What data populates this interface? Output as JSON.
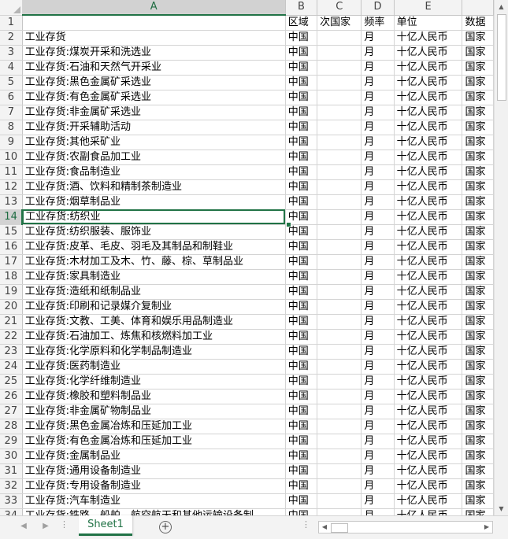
{
  "columns": [
    "A",
    "B",
    "C",
    "D",
    "E",
    ""
  ],
  "active_column": "A",
  "rows": [
    {
      "n": "1",
      "a": "",
      "b": "区域",
      "c": "次国家",
      "d": "频率",
      "e": "单位",
      "f": "数据"
    },
    {
      "n": "2",
      "a": "工业存货",
      "b": "中国",
      "c": "",
      "d": "月",
      "e": "十亿人民币",
      "f": "国家"
    },
    {
      "n": "3",
      "a": "工业存货:煤炭开采和洗选业",
      "b": "中国",
      "c": "",
      "d": "月",
      "e": "十亿人民币",
      "f": "国家"
    },
    {
      "n": "4",
      "a": "工业存货:石油和天然气开采业",
      "b": "中国",
      "c": "",
      "d": "月",
      "e": "十亿人民币",
      "f": "国家"
    },
    {
      "n": "5",
      "a": "工业存货:黑色金属矿采选业",
      "b": "中国",
      "c": "",
      "d": "月",
      "e": "十亿人民币",
      "f": "国家"
    },
    {
      "n": "6",
      "a": "工业存货:有色金属矿采选业",
      "b": "中国",
      "c": "",
      "d": "月",
      "e": "十亿人民币",
      "f": "国家"
    },
    {
      "n": "7",
      "a": "工业存货:非金属矿采选业",
      "b": "中国",
      "c": "",
      "d": "月",
      "e": "十亿人民币",
      "f": "国家"
    },
    {
      "n": "8",
      "a": "工业存货:开采辅助活动",
      "b": "中国",
      "c": "",
      "d": "月",
      "e": "十亿人民币",
      "f": "国家"
    },
    {
      "n": "9",
      "a": "工业存货:其他采矿业",
      "b": "中国",
      "c": "",
      "d": "月",
      "e": "十亿人民币",
      "f": "国家"
    },
    {
      "n": "10",
      "a": "工业存货:农副食品加工业",
      "b": "中国",
      "c": "",
      "d": "月",
      "e": "十亿人民币",
      "f": "国家"
    },
    {
      "n": "11",
      "a": "工业存货:食品制造业",
      "b": "中国",
      "c": "",
      "d": "月",
      "e": "十亿人民币",
      "f": "国家"
    },
    {
      "n": "12",
      "a": "工业存货:酒、饮料和精制茶制造业",
      "b": "中国",
      "c": "",
      "d": "月",
      "e": "十亿人民币",
      "f": "国家"
    },
    {
      "n": "13",
      "a": "工业存货:烟草制品业",
      "b": "中国",
      "c": "",
      "d": "月",
      "e": "十亿人民币",
      "f": "国家"
    },
    {
      "n": "14",
      "a": "工业存货:纺织业",
      "b": "中国",
      "c": "",
      "d": "月",
      "e": "十亿人民币",
      "f": "国家"
    },
    {
      "n": "15",
      "a": "工业存货:纺织服装、服饰业",
      "b": "中国",
      "c": "",
      "d": "月",
      "e": "十亿人民币",
      "f": "国家"
    },
    {
      "n": "16",
      "a": "工业存货:皮革、毛皮、羽毛及其制品和制鞋业",
      "b": "中国",
      "c": "",
      "d": "月",
      "e": "十亿人民币",
      "f": "国家"
    },
    {
      "n": "17",
      "a": "工业存货:木材加工及木、竹、藤、棕、草制品业",
      "b": "中国",
      "c": "",
      "d": "月",
      "e": "十亿人民币",
      "f": "国家"
    },
    {
      "n": "18",
      "a": "工业存货:家具制造业",
      "b": "中国",
      "c": "",
      "d": "月",
      "e": "十亿人民币",
      "f": "国家"
    },
    {
      "n": "19",
      "a": "工业存货:造纸和纸制品业",
      "b": "中国",
      "c": "",
      "d": "月",
      "e": "十亿人民币",
      "f": "国家"
    },
    {
      "n": "20",
      "a": "工业存货:印刷和记录媒介复制业",
      "b": "中国",
      "c": "",
      "d": "月",
      "e": "十亿人民币",
      "f": "国家"
    },
    {
      "n": "21",
      "a": "工业存货:文教、工美、体育和娱乐用品制造业",
      "b": "中国",
      "c": "",
      "d": "月",
      "e": "十亿人民币",
      "f": "国家"
    },
    {
      "n": "22",
      "a": "工业存货:石油加工、炼焦和核燃料加工业",
      "b": "中国",
      "c": "",
      "d": "月",
      "e": "十亿人民币",
      "f": "国家"
    },
    {
      "n": "23",
      "a": "工业存货:化学原料和化学制品制造业",
      "b": "中国",
      "c": "",
      "d": "月",
      "e": "十亿人民币",
      "f": "国家"
    },
    {
      "n": "24",
      "a": "工业存货:医药制造业",
      "b": "中国",
      "c": "",
      "d": "月",
      "e": "十亿人民币",
      "f": "国家"
    },
    {
      "n": "25",
      "a": "工业存货:化学纤维制造业",
      "b": "中国",
      "c": "",
      "d": "月",
      "e": "十亿人民币",
      "f": "国家"
    },
    {
      "n": "26",
      "a": "工业存货:橡胶和塑料制品业",
      "b": "中国",
      "c": "",
      "d": "月",
      "e": "十亿人民币",
      "f": "国家"
    },
    {
      "n": "27",
      "a": "工业存货:非金属矿物制品业",
      "b": "中国",
      "c": "",
      "d": "月",
      "e": "十亿人民币",
      "f": "国家"
    },
    {
      "n": "28",
      "a": "工业存货:黑色金属冶炼和压延加工业",
      "b": "中国",
      "c": "",
      "d": "月",
      "e": "十亿人民币",
      "f": "国家"
    },
    {
      "n": "29",
      "a": "工业存货:有色金属冶炼和压延加工业",
      "b": "中国",
      "c": "",
      "d": "月",
      "e": "十亿人民币",
      "f": "国家"
    },
    {
      "n": "30",
      "a": "工业存货:金属制品业",
      "b": "中国",
      "c": "",
      "d": "月",
      "e": "十亿人民币",
      "f": "国家"
    },
    {
      "n": "31",
      "a": "工业存货:通用设备制造业",
      "b": "中国",
      "c": "",
      "d": "月",
      "e": "十亿人民币",
      "f": "国家"
    },
    {
      "n": "32",
      "a": "工业存货:专用设备制造业",
      "b": "中国",
      "c": "",
      "d": "月",
      "e": "十亿人民币",
      "f": "国家"
    },
    {
      "n": "33",
      "a": "工业存货:汽车制造业",
      "b": "中国",
      "c": "",
      "d": "月",
      "e": "十亿人民币",
      "f": "国家"
    },
    {
      "n": "34",
      "a": "工业存货:铁路、船舶、航空航天和其他运输设备制",
      "b": "中国",
      "c": "",
      "d": "月",
      "e": "十亿人民币",
      "f": "国家"
    }
  ],
  "selected_row": "14",
  "sheet_tabs": [
    {
      "label": "Sheet1",
      "active": true
    }
  ],
  "icons": {
    "tab_prev": "triangle-left-icon",
    "tab_next": "triangle-right-icon",
    "add_sheet": "plus-circle-icon",
    "scroll_up": "triangle-up-icon",
    "scroll_down": "triangle-down-icon",
    "scroll_left": "triangle-left-icon",
    "scroll_right": "triangle-right-icon"
  },
  "colors": {
    "accent": "#217346",
    "header_bg": "#f3f3f3",
    "gridline": "#d4d4d4"
  }
}
